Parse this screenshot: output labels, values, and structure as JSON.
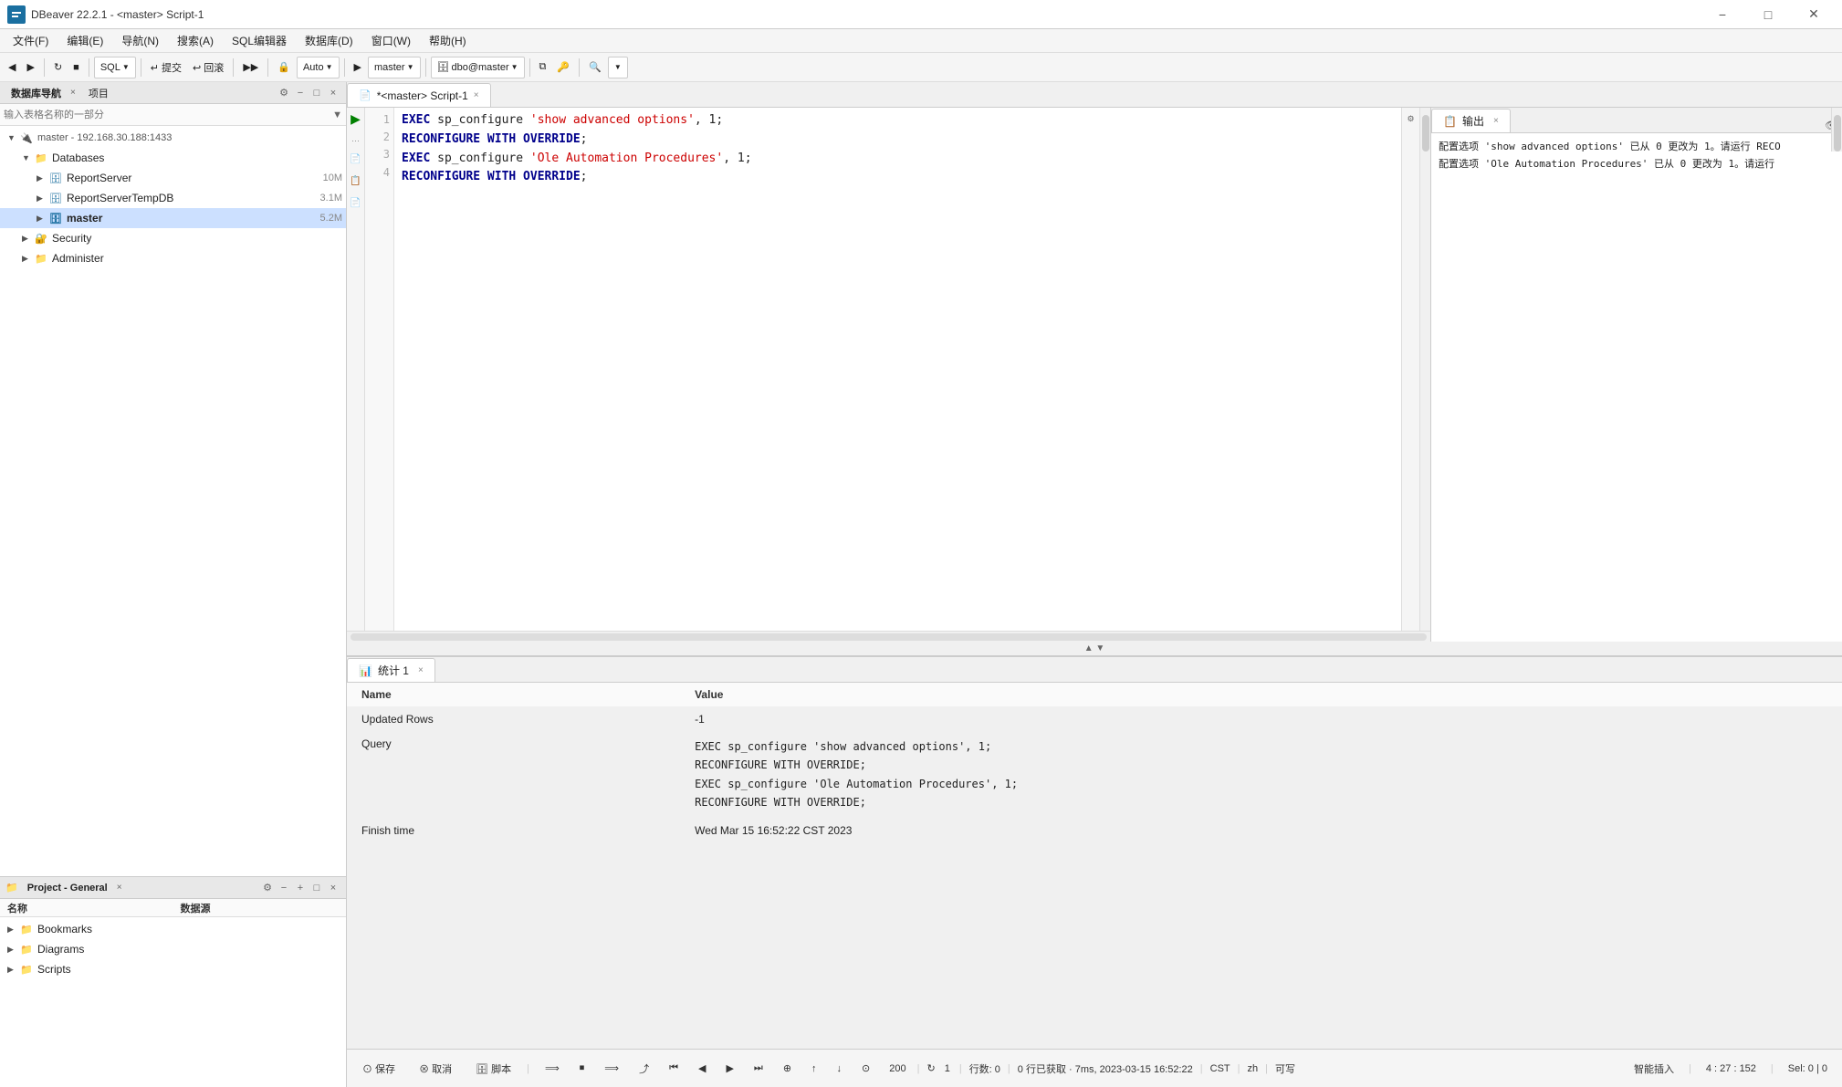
{
  "titleBar": {
    "title": "DBeaver 22.2.1 - <master> Script-1",
    "appIcon": "DB",
    "minimize": "−",
    "maximize": "□",
    "close": "✕"
  },
  "menuBar": {
    "items": [
      "文件(F)",
      "编辑(E)",
      "导航(N)",
      "搜索(A)",
      "SQL编辑器",
      "数据库(D)",
      "窗口(W)",
      "帮助(H)"
    ]
  },
  "toolbar": {
    "sqlLabel": "SQL",
    "submitLabel": "↵提交",
    "rollbackLabel": "↩回滚",
    "autoLabel": "Auto",
    "masterLabel": "master",
    "dboMasterLabel": "dbo@master"
  },
  "dbNav": {
    "tabLabel": "数据库导航",
    "projectTabLabel": "项目",
    "searchPlaceholder": "输入表格名称的一部分",
    "connection": "master - 192.168.30.188:1433",
    "databases": [
      {
        "name": "Databases",
        "type": "folder",
        "indent": 1
      },
      {
        "name": "ReportServer",
        "type": "table",
        "size": "10M",
        "indent": 2
      },
      {
        "name": "ReportServerTempDB",
        "type": "table",
        "size": "3.1M",
        "indent": 2
      },
      {
        "name": "master",
        "type": "master",
        "size": "5.2M",
        "indent": 2,
        "selected": true
      },
      {
        "name": "Security",
        "type": "security",
        "size": "",
        "indent": 2
      },
      {
        "name": "Administer",
        "type": "folder",
        "size": "",
        "indent": 2
      }
    ]
  },
  "projectPanel": {
    "tabLabel": "Project - General",
    "closeLabel": "×",
    "colName": "名称",
    "colDataSource": "数据源",
    "items": [
      {
        "name": "Bookmarks",
        "type": "folder",
        "indent": 0
      },
      {
        "name": "Diagrams",
        "type": "folder",
        "indent": 0
      },
      {
        "name": "Scripts",
        "type": "folder",
        "indent": 0
      }
    ]
  },
  "editorTab": {
    "title": "*<master> Script-1",
    "closeLabel": "×"
  },
  "outputTab": {
    "title": "输出",
    "closeLabel": "×"
  },
  "code": {
    "line1": "EXEC sp_configure 'show advanced options', 1;",
    "line2": "RECONFIGURE WITH OVERRIDE;",
    "line3": "EXEC sp_configure 'Ole Automation Procedures', 1;",
    "line4": "RECONFIGURE WITH OVERRIDE;"
  },
  "outputContent": {
    "line1": "配置选项 'show advanced options' 已从 0 更改为 1。请运行 RECO",
    "line2": "配置选项 'Ole Automation Procedures' 已从 0 更改为 1。请运行"
  },
  "statsTab": {
    "title": "统计 1",
    "closeLabel": "×"
  },
  "statsTable": {
    "headers": [
      "Name",
      "Value"
    ],
    "rows": [
      {
        "name": "Name",
        "value": "Value"
      },
      {
        "name": "Updated Rows",
        "value": "-1"
      },
      {
        "name": "Query",
        "value": "EXEC sp_configure 'show advanced options', 1;\nRECONFIGURE WITH OVERRIDE;\nEXEC sp_configure 'Ole Automation Procedures', 1;\nRECONFIGURE WITH OVERRIDE;"
      },
      {
        "name": "Finish time",
        "value": "Wed Mar 15 16:52:22 CST 2023"
      }
    ]
  },
  "statusBar": {
    "save": "⊙保存",
    "cancel": "⊗取消",
    "script": "🗄脚本",
    "lineCount": "200",
    "lineInfo": "1",
    "rowInfo": "行数: 0",
    "fetchInfo": "0 行已获取 · 7ms, 2023-03-15 16:52:22",
    "timeZone": "CST",
    "lang": "zh",
    "mode": "可写",
    "inputMode": "智能插入",
    "position": "4 : 27 : 152",
    "selection": "Sel: 0 | 0"
  }
}
